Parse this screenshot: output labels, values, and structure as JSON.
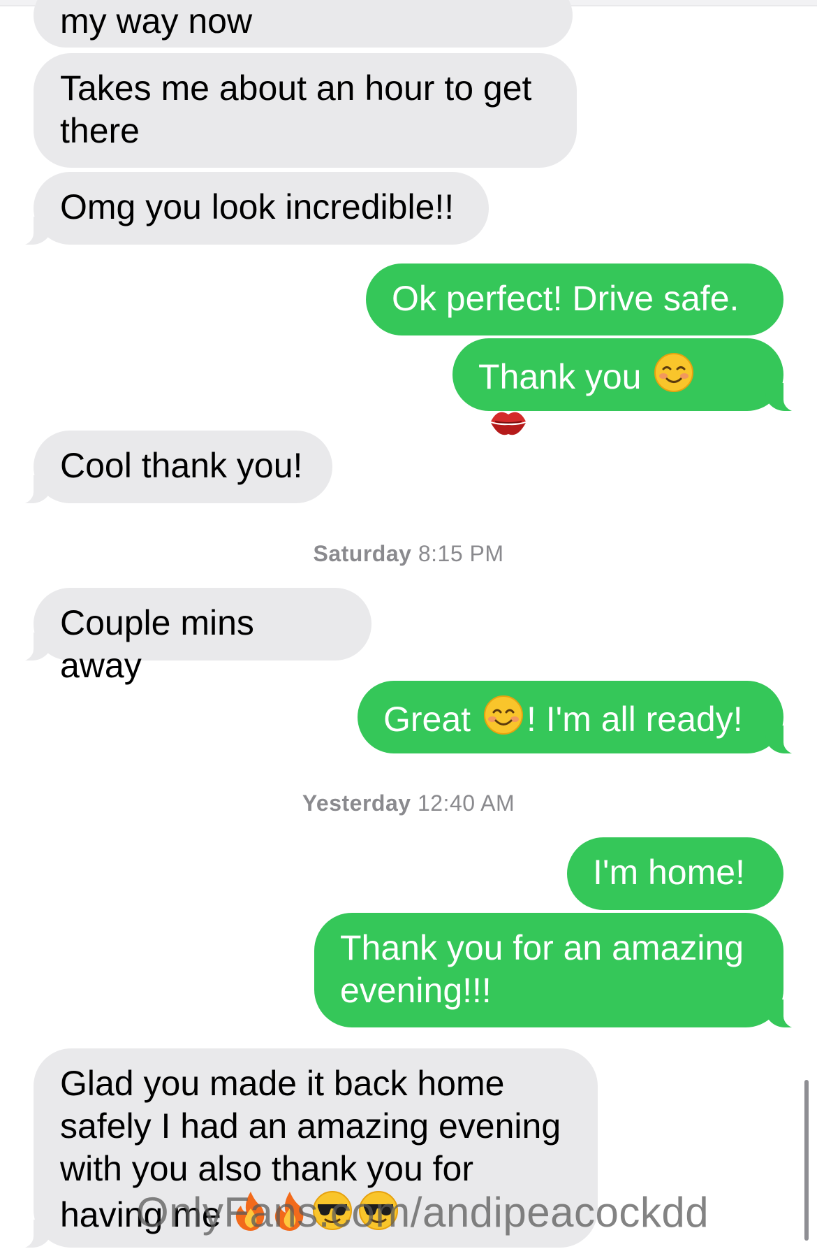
{
  "messages": [
    {
      "side": "received",
      "text": "my way now"
    },
    {
      "side": "received",
      "text": "Takes me about an hour to get there"
    },
    {
      "side": "received",
      "text": "Omg you look incredible!!"
    },
    {
      "side": "sent",
      "text": "Ok perfect! Drive safe."
    },
    {
      "side": "sent",
      "text": "Thank you",
      "emojis": [
        "smiling-blush-emoji",
        "kiss-mark-emoji"
      ]
    },
    {
      "side": "received",
      "text": "Cool thank you!"
    },
    {
      "side": "received",
      "text": "Couple mins away"
    },
    {
      "side": "sent",
      "text_before": "Great",
      "text_after": "! I'm all ready!",
      "emojis": [
        "smiling-face-emoji"
      ]
    },
    {
      "side": "sent",
      "text": "I'm home!"
    },
    {
      "side": "sent",
      "text": "Thank you for an amazing evening!!!"
    },
    {
      "side": "received",
      "text": "Glad you made it back home safely I had an amazing evening with you also thank you for having me",
      "emojis": [
        "fire-emoji",
        "fire-emoji",
        "sunglasses-emoji",
        "sunglasses-emoji"
      ]
    }
  ],
  "timestamps": [
    {
      "day": "Saturday",
      "time": "8:15 PM"
    },
    {
      "day": "Yesterday",
      "time": "12:40 AM"
    }
  ],
  "watermark": "OnlyFans.com/andipeacockdd",
  "colors": {
    "sent_bubble": "#35c759",
    "received_bubble": "#e9e9eb",
    "timestamp_text": "#8a8a8e"
  }
}
